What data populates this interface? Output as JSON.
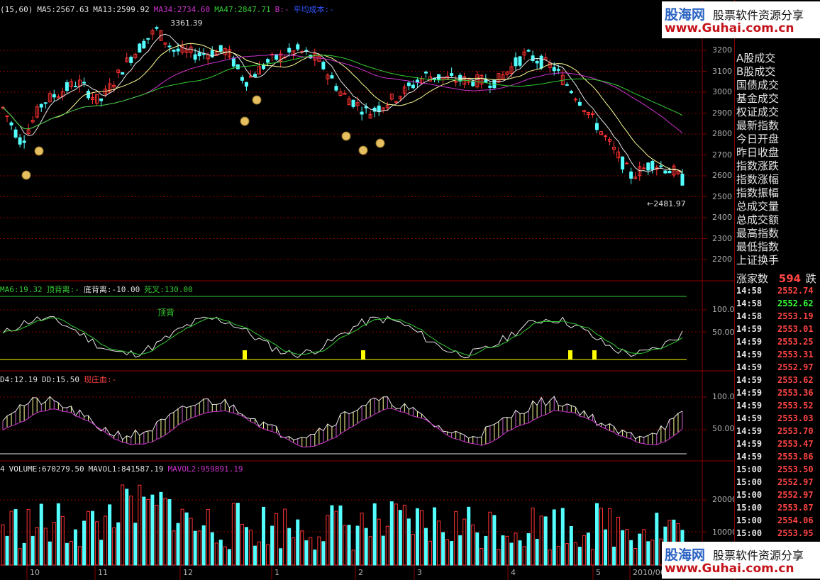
{
  "main_panel": {
    "legend": [
      {
        "text": "(15,60)",
        "color": "#e0e0e0"
      },
      {
        "text": "MA5:2567.63",
        "color": "#e0e0e0"
      },
      {
        "text": "MA13:2599.92",
        "color": "#e0e0e0"
      },
      {
        "text": "MA34:2734.60",
        "color": "#cc33cc"
      },
      {
        "text": "MA47:2847.71",
        "color": "#33cc33"
      },
      {
        "text": "B:-",
        "color": "#cc33cc"
      },
      {
        "text": "平均成本:-",
        "color": "#3355ff"
      }
    ],
    "high_annotation": "3361.39",
    "low_annotation": "←2481.97",
    "y_ticks": [
      "3200",
      "3100",
      "3000",
      "2900",
      "2800",
      "2700",
      "2600",
      "2500",
      "2400",
      "2300",
      "2200"
    ]
  },
  "panel2": {
    "legend": [
      {
        "text": "MA6:19.32",
        "color": "#33cc33"
      },
      {
        "text": "顶背离:-",
        "color": "#33cc33"
      },
      {
        "text": "底背离:-10.00",
        "color": "#e0e0e0"
      },
      {
        "text": "死叉:130.00",
        "color": "#33cc33"
      }
    ],
    "top_label": "顶背",
    "y_ticks": [
      "100.0",
      "50.00"
    ]
  },
  "panel3": {
    "legend": [
      {
        "text": "D4:12.19",
        "color": "#e0e0e0"
      },
      {
        "text": "DD:15.50",
        "color": "#e0e0e0"
      },
      {
        "text": "现庄血:-",
        "color": "#ff4444"
      }
    ],
    "y_ticks": [
      "100.0",
      "50.00"
    ]
  },
  "panel4": {
    "legend": [
      {
        "text": "4",
        "color": "#e0e0e0"
      },
      {
        "text": "VOLUME:670279.50",
        "color": "#e0e0e0"
      },
      {
        "text": "MAVOL1:841587.19",
        "color": "#e0e0e0"
      },
      {
        "text": "MAVOL2:959891.19",
        "color": "#cc33cc"
      }
    ],
    "y_ticks": [
      "20000",
      "10000"
    ]
  },
  "date_axis": [
    "10",
    "11",
    "12",
    "1",
    "2",
    "3",
    "4",
    "5",
    "2010/06"
  ],
  "right_panel": {
    "menu_items": [
      "A股成交",
      "B股成交",
      "国债成交",
      "基金成交",
      "权证成交",
      "最新指数",
      "今日开盘",
      "昨日收盘",
      "指数涨跌",
      "指数涨幅",
      "指数振幅",
      "总成交量",
      "总成交额",
      "最高指数",
      "最低指数",
      "上证换手"
    ],
    "up_count_label": "涨家数",
    "up_count_value": "594",
    "down_label": "跌",
    "ticks": [
      {
        "time": "14:58",
        "price": "2552.74",
        "color": "#ff4444"
      },
      {
        "time": "14:58",
        "price": "2552.62",
        "color": "#33ff33"
      },
      {
        "time": "14:58",
        "price": "2553.19",
        "color": "#ff4444"
      },
      {
        "time": "14:59",
        "price": "2553.01",
        "color": "#ff4444"
      },
      {
        "time": "14:59",
        "price": "2553.25",
        "color": "#ff4444"
      },
      {
        "time": "14:59",
        "price": "2553.31",
        "color": "#ff4444"
      },
      {
        "time": "14:59",
        "price": "2552.97",
        "color": "#ff4444"
      },
      {
        "time": "14:59",
        "price": "2553.62",
        "color": "#ff4444"
      },
      {
        "time": "14:59",
        "price": "2553.36",
        "color": "#ff4444"
      },
      {
        "time": "14:59",
        "price": "2553.52",
        "color": "#ff4444"
      },
      {
        "time": "14:59",
        "price": "2553.03",
        "color": "#ff4444"
      },
      {
        "time": "14:59",
        "price": "2553.70",
        "color": "#ff4444"
      },
      {
        "time": "14:59",
        "price": "2553.47",
        "color": "#ff4444"
      },
      {
        "time": "14:59",
        "price": "2553.86",
        "color": "#ff4444"
      },
      {
        "time": "15:00",
        "price": "2553.50",
        "color": "#ff4444"
      },
      {
        "time": "15:00",
        "price": "2552.97",
        "color": "#ff4444"
      },
      {
        "time": "15:00",
        "price": "2552.97",
        "color": "#ff4444"
      },
      {
        "time": "15:00",
        "price": "2553.87",
        "color": "#ff4444"
      },
      {
        "time": "15:00",
        "price": "2554.06",
        "color": "#ff4444"
      },
      {
        "time": "15:00",
        "price": "2553.95",
        "color": "#ff4444"
      }
    ]
  },
  "watermark": {
    "logo": "股海网",
    "slogan": "股票软件资源分享",
    "url": "www.Guhai.com.cn",
    "url_bottom": "www.Guhai.com.cn"
  },
  "colors": {
    "up": "#ff3333",
    "down": "#54ffff",
    "grid": "#8b0000",
    "accent": "#ffff00"
  }
}
